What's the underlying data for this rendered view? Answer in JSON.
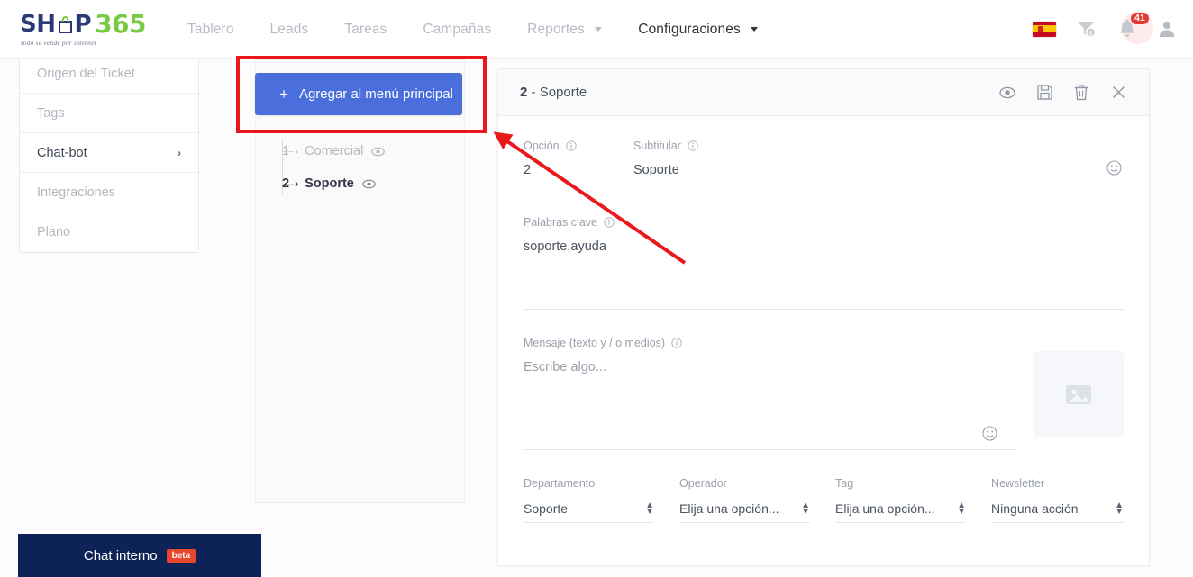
{
  "brand": {
    "logo_sh": "SH",
    "logo_p": "P",
    "logo_365": "365",
    "tagline": "Todo se vende por internet",
    "accent_blue": "#4a6fdd",
    "accent_green": "#7ac943",
    "navy": "#0d2357",
    "annotation_red": "#e8181c"
  },
  "topnav": {
    "items": [
      {
        "label": "Tablero",
        "active": false,
        "caret": false
      },
      {
        "label": "Leads",
        "active": false,
        "caret": false
      },
      {
        "label": "Tareas",
        "active": false,
        "caret": false
      },
      {
        "label": "Campañas",
        "active": false,
        "caret": false
      },
      {
        "label": "Reportes",
        "active": false,
        "caret": true
      },
      {
        "label": "Configuraciones",
        "active": true,
        "caret": true
      }
    ],
    "right": {
      "language_icon": "spain-flag-icon",
      "funnel_icon": "sales-funnel-icon",
      "notifications_icon": "bell-icon",
      "notifications_count": "41",
      "account_icon": "user-avatar-icon"
    }
  },
  "settings_menu": {
    "items": [
      {
        "label": "Origen del Ticket",
        "active": false,
        "chevron": ""
      },
      {
        "label": "Tags",
        "active": false,
        "chevron": ""
      },
      {
        "label": "Chat-bot",
        "active": true,
        "chevron": "›"
      },
      {
        "label": "Integraciones",
        "active": false,
        "chevron": ""
      },
      {
        "label": "Plano",
        "active": false,
        "chevron": ""
      }
    ]
  },
  "tree": {
    "add_button_label": "Agregar al menú principal",
    "add_button_plus": "+",
    "nodes": [
      {
        "num": "1",
        "arrow": "›",
        "label": "Comercial",
        "selected": false,
        "eye_icon": "eye-icon"
      },
      {
        "num": "2",
        "arrow": "›",
        "label": "Soporte",
        "selected": true,
        "eye_icon": "eye-icon"
      }
    ]
  },
  "panel": {
    "title_number": "2",
    "title_sep": " - ",
    "title_name": "Soporte",
    "actions": [
      {
        "name": "preview-icon",
        "title": "Vista previa"
      },
      {
        "name": "save-icon",
        "title": "Guardar"
      },
      {
        "name": "delete-icon",
        "title": "Eliminar"
      },
      {
        "name": "close-icon",
        "title": "Cerrar"
      }
    ],
    "fields": {
      "opcion": {
        "label": "Opción",
        "value": "2",
        "info": "ⓘ"
      },
      "subtitular": {
        "label": "Subtitular",
        "value": "Soporte",
        "info": "ⓘ",
        "emoji_icon": "emoji-icon"
      },
      "palabras_clave": {
        "label": "Palabras clave",
        "value": "soporte,ayuda",
        "info": "ⓘ"
      },
      "mensaje": {
        "label": "Mensaje (texto y / o medios)",
        "placeholder": "Escribe algo...",
        "info": "ⓘ",
        "emoji_icon": "emoji-icon",
        "media_icon": "image-placeholder-icon"
      }
    },
    "selects": [
      {
        "label": "Departamento",
        "value": "Soporte"
      },
      {
        "label": "Operador",
        "value": "Elija una opción..."
      },
      {
        "label": "Tag",
        "value": "Elija una opción..."
      },
      {
        "label": "Newsletter",
        "value": "Ninguna acción"
      }
    ]
  },
  "chatbar": {
    "label": "Chat interno",
    "badge": "beta"
  }
}
